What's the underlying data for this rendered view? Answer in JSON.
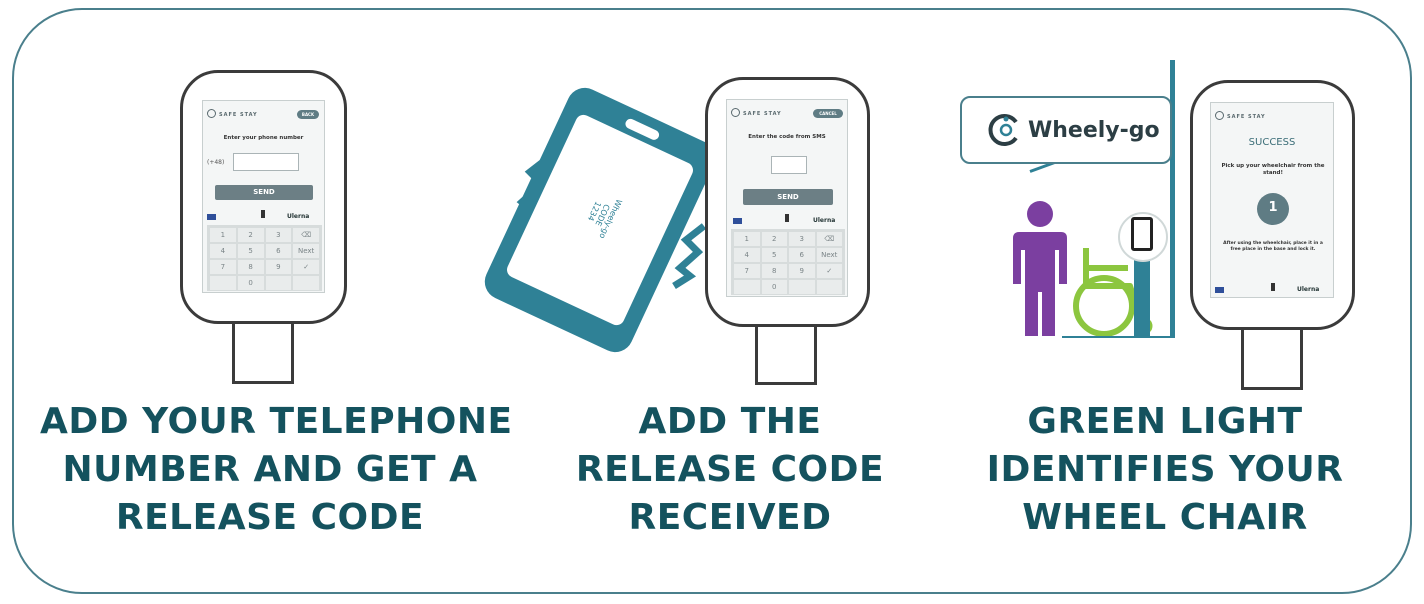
{
  "steps": [
    {
      "caption_lines": [
        "ADD YOUR TELEPHONE",
        "NUMBER AND GET A",
        "RELEASE CODE"
      ],
      "screen": {
        "brand": "SAFE STAY",
        "pill": "BACK",
        "prompt": "Enter your phone number",
        "prefix": "(+48)",
        "send_label": "SEND",
        "logo_text": "Ulerna",
        "keys": [
          "1",
          "2",
          "3",
          "⌫",
          "4",
          "5",
          "6",
          "Next",
          "7",
          "8",
          "9",
          "✓",
          "",
          "0",
          "",
          ""
        ]
      }
    },
    {
      "caption_lines": [
        "ADD THE",
        "RELEASE CODE",
        "RECEIVED"
      ],
      "phone_text_lines": [
        "Wheely-go",
        "CODE",
        "1234"
      ],
      "screen": {
        "brand": "SAFE STAY",
        "pill": "CANCEL",
        "prompt": "Enter the code from SMS",
        "send_label": "SEND",
        "logo_text": "Ulerna",
        "keys": [
          "1",
          "2",
          "3",
          "⌫",
          "4",
          "5",
          "6",
          "Next",
          "7",
          "8",
          "9",
          "✓",
          "",
          "0",
          "",
          ""
        ]
      }
    },
    {
      "caption_lines": [
        "GREEN LIGHT",
        "IDENTIFIES YOUR",
        "WHEEL CHAIR"
      ],
      "bubble_label": "Wheely-go",
      "screen": {
        "brand": "SAFE STAY",
        "title": "SUCCESS",
        "prompt": "Pick up your wheelchair from the stand!",
        "number": "1",
        "note": "After using the wheelchair, place it in a free place in the base and lock it.",
        "logo_text": "Ulerna"
      }
    }
  ],
  "colors": {
    "teal": "#2f8196",
    "caption": "#14525e",
    "person": "#7b3fa0",
    "wheelchair": "#8cc63f",
    "frame": "#4a7f8c"
  },
  "icons": [
    "smartphone-icon",
    "wheelchair-icon",
    "person-icon",
    "wheely-go-logo-icon",
    "vibration-icon"
  ]
}
